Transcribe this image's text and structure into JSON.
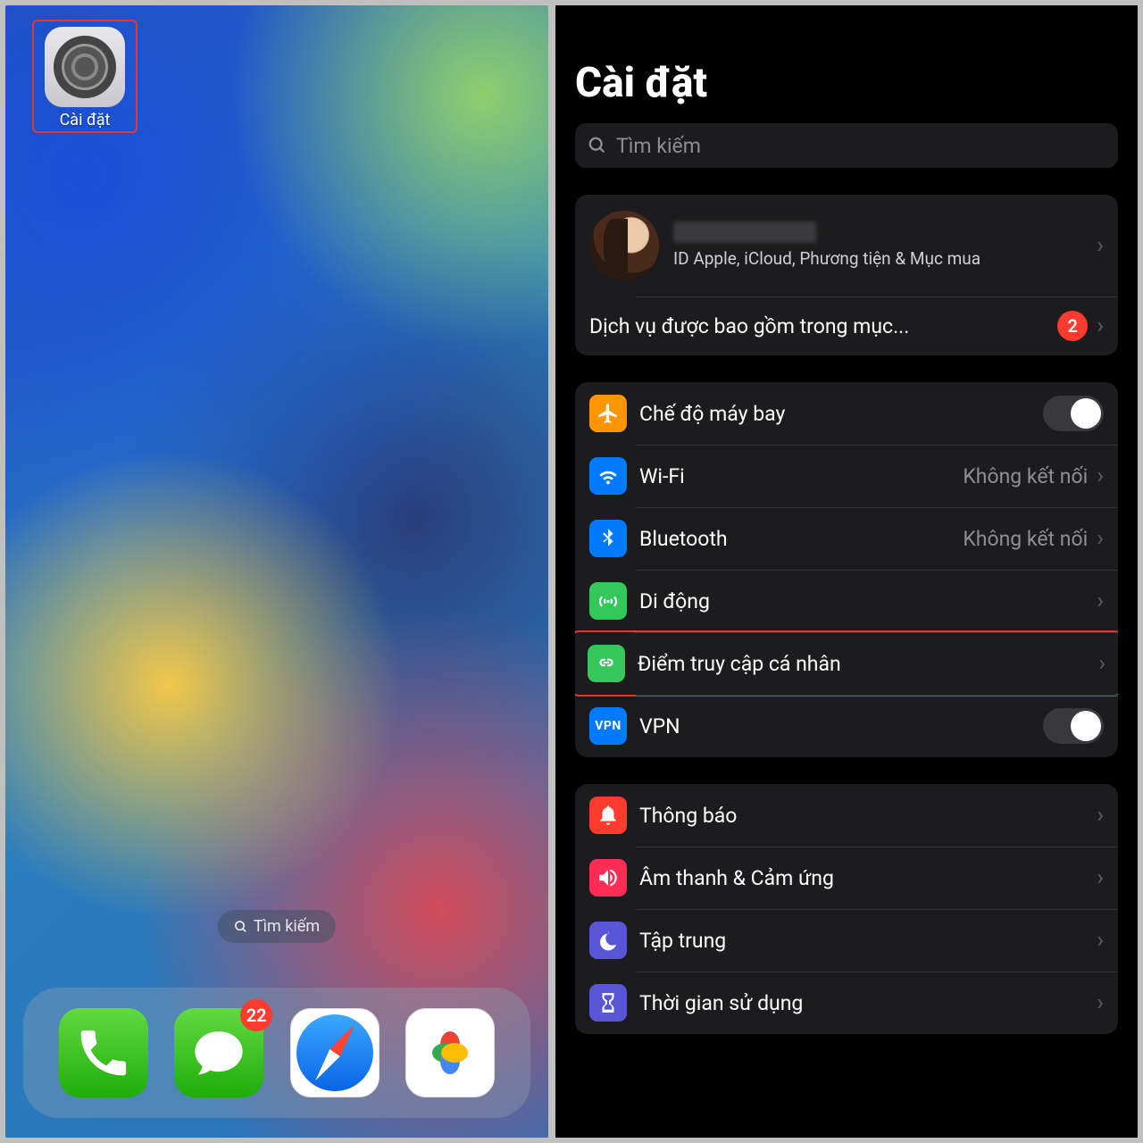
{
  "home": {
    "settings_app_label": "Cài đặt",
    "search_pill": "Tìm kiếm",
    "dock": {
      "phone": "Phone",
      "messages": "Messages",
      "messages_badge": "22",
      "safari": "Safari",
      "photos": "Photos"
    }
  },
  "settings": {
    "title": "Cài đặt",
    "search_placeholder": "Tìm kiếm",
    "profile": {
      "subtitle": "ID Apple, iCloud, Phương tiện & Mục mua"
    },
    "included_services": {
      "label": "Dịch vụ được bao gồm trong mục...",
      "count": "2"
    },
    "rows": {
      "airplane": "Chế độ máy bay",
      "wifi": "Wi-Fi",
      "wifi_value": "Không kết nối",
      "bluetooth": "Bluetooth",
      "bluetooth_value": "Không kết nối",
      "cellular": "Di động",
      "hotspot": "Điểm truy cập cá nhân",
      "vpn": "VPN",
      "vpn_icon_text": "VPN",
      "notifications": "Thông báo",
      "sound": "Âm thanh & Cảm ứng",
      "focus": "Tập trung",
      "screentime": "Thời gian sử dụng"
    }
  }
}
